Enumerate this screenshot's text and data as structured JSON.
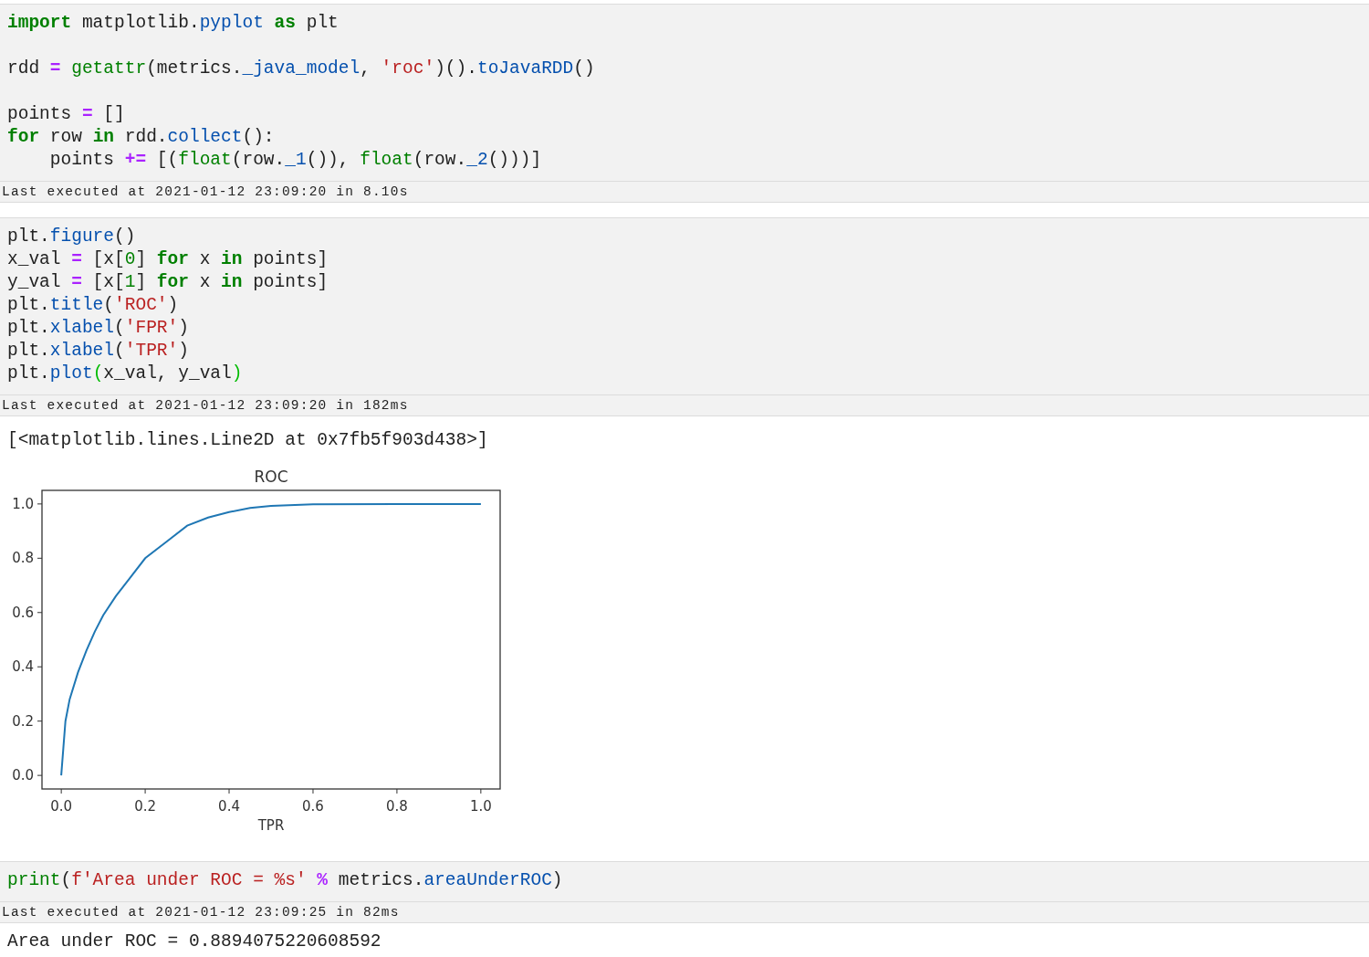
{
  "cells": [
    {
      "kind": "code",
      "lines": [
        {
          "tokens": [
            {
              "kind": "kw",
              "text": "import"
            },
            {
              "kind": "p",
              "text": " matplotlib."
            },
            {
              "kind": "prop",
              "text": "pyplot"
            },
            {
              "kind": "kw",
              "text": " as"
            },
            {
              "kind": "p",
              "text": " plt"
            }
          ]
        },
        {
          "gap_before": true,
          "tokens": [
            {
              "kind": "p",
              "text": "rdd "
            },
            {
              "kind": "op",
              "text": "="
            },
            {
              "kind": "bi",
              "text": " getattr"
            },
            {
              "kind": "p",
              "text": "(metrics."
            },
            {
              "kind": "prop",
              "text": "_java_model"
            },
            {
              "kind": "p",
              "text": ", "
            },
            {
              "kind": "str",
              "text": "'roc'"
            },
            {
              "kind": "p",
              "text": ")()."
            },
            {
              "kind": "prop",
              "text": "toJavaRDD"
            },
            {
              "kind": "p",
              "text": "()"
            }
          ]
        },
        {
          "gap_before": true,
          "tokens": [
            {
              "kind": "p",
              "text": "points "
            },
            {
              "kind": "op",
              "text": "="
            },
            {
              "kind": "p",
              "text": " []"
            }
          ]
        },
        {
          "tokens": [
            {
              "kind": "kw",
              "text": "for"
            },
            {
              "kind": "p",
              "text": " row "
            },
            {
              "kind": "kw",
              "text": "in"
            },
            {
              "kind": "p",
              "text": " rdd."
            },
            {
              "kind": "prop",
              "text": "collect"
            },
            {
              "kind": "p",
              "text": "():"
            }
          ]
        },
        {
          "tokens": [
            {
              "kind": "p",
              "text": "    points "
            },
            {
              "kind": "op",
              "text": "+="
            },
            {
              "kind": "p",
              "text": " [("
            },
            {
              "kind": "bi",
              "text": "float"
            },
            {
              "kind": "p",
              "text": "(row."
            },
            {
              "kind": "prop",
              "text": "_1"
            },
            {
              "kind": "p",
              "text": "()), "
            },
            {
              "kind": "bi",
              "text": "float"
            },
            {
              "kind": "p",
              "text": "(row."
            },
            {
              "kind": "prop",
              "text": "_2"
            },
            {
              "kind": "p",
              "text": "()))]"
            }
          ]
        }
      ],
      "footer": "Last executed at 2021-01-12 23:09:20 in 8.10s"
    },
    {
      "kind": "code",
      "lines": [
        {
          "tokens": [
            {
              "kind": "p",
              "text": "plt."
            },
            {
              "kind": "prop",
              "text": "figure"
            },
            {
              "kind": "p",
              "text": "()"
            }
          ]
        },
        {
          "tokens": [
            {
              "kind": "p",
              "text": "x_val "
            },
            {
              "kind": "op",
              "text": "="
            },
            {
              "kind": "p",
              "text": " [x["
            },
            {
              "kind": "num",
              "text": "0"
            },
            {
              "kind": "p",
              "text": "] "
            },
            {
              "kind": "kw",
              "text": "for"
            },
            {
              "kind": "p",
              "text": " x "
            },
            {
              "kind": "kw",
              "text": "in"
            },
            {
              "kind": "p",
              "text": " points]"
            }
          ]
        },
        {
          "tokens": [
            {
              "kind": "p",
              "text": "y_val "
            },
            {
              "kind": "op",
              "text": "="
            },
            {
              "kind": "p",
              "text": " [x["
            },
            {
              "kind": "num",
              "text": "1"
            },
            {
              "kind": "p",
              "text": "] "
            },
            {
              "kind": "kw",
              "text": "for"
            },
            {
              "kind": "p",
              "text": " x "
            },
            {
              "kind": "kw",
              "text": "in"
            },
            {
              "kind": "p",
              "text": " points]"
            }
          ]
        },
        {
          "tokens": [
            {
              "kind": "p",
              "text": "plt."
            },
            {
              "kind": "prop",
              "text": "title"
            },
            {
              "kind": "p",
              "text": "("
            },
            {
              "kind": "str",
              "text": "'ROC'"
            },
            {
              "kind": "p",
              "text": ")"
            }
          ]
        },
        {
          "tokens": [
            {
              "kind": "p",
              "text": "plt."
            },
            {
              "kind": "prop",
              "text": "xlabel"
            },
            {
              "kind": "p",
              "text": "("
            },
            {
              "kind": "str",
              "text": "'FPR'"
            },
            {
              "kind": "p",
              "text": ")"
            }
          ]
        },
        {
          "tokens": [
            {
              "kind": "p",
              "text": "plt."
            },
            {
              "kind": "prop",
              "text": "xlabel"
            },
            {
              "kind": "p",
              "text": "("
            },
            {
              "kind": "str",
              "text": "'TPR'"
            },
            {
              "kind": "p",
              "text": ")"
            }
          ]
        },
        {
          "tokens": [
            {
              "kind": "p",
              "text": "plt."
            },
            {
              "kind": "prop",
              "text": "plot"
            },
            {
              "kind": "match",
              "text": "("
            },
            {
              "kind": "p",
              "text": "x_val, y_val"
            },
            {
              "kind": "match",
              "text": ")"
            }
          ]
        }
      ],
      "footer": "Last executed at 2021-01-12 23:09:20 in 182ms",
      "outputs": [
        {
          "kind": "text",
          "text": "[<matplotlib.lines.Line2D at 0x7fb5f903d438>]"
        },
        {
          "kind": "chart",
          "chart_data": {
            "type": "line",
            "title": "ROC",
            "xlabel": "TPR",
            "x": [
              0,
              0.005,
              0.01,
              0.02,
              0.04,
              0.06,
              0.08,
              0.1,
              0.13,
              0.16,
              0.2,
              0.25,
              0.3,
              0.35,
              0.4,
              0.45,
              0.5,
              0.6,
              0.8,
              1.0
            ],
            "series": [
              {
                "color": "#1f77b4",
                "values": [
                  0,
                  0.1,
                  0.2,
                  0.28,
                  0.38,
                  0.46,
                  0.53,
                  0.59,
                  0.66,
                  0.72,
                  0.8,
                  0.86,
                  0.92,
                  0.95,
                  0.97,
                  0.985,
                  0.993,
                  0.999,
                  1.0,
                  1.0
                ]
              }
            ],
            "xticks": [
              {
                "value": 0,
                "label": "0.0"
              },
              0.2,
              0.4,
              0.6,
              0.8,
              {
                "value": 1,
                "label": "1.0"
              }
            ],
            "yticks": [
              {
                "value": 0,
                "label": "0.0"
              },
              0.2,
              0.4,
              0.6,
              0.8,
              {
                "value": 1,
                "label": "1.0"
              }
            ],
            "xlim": [
              -0.046,
              1.046
            ],
            "ylim": [
              -0.05,
              1.05
            ]
          }
        }
      ]
    },
    {
      "kind": "code",
      "lines": [
        {
          "tokens": [
            {
              "kind": "bi",
              "text": "print"
            },
            {
              "kind": "p",
              "text": "("
            },
            {
              "kind": "str",
              "text": "f'Area under ROC = %s'"
            },
            {
              "kind": "op",
              "text": " %"
            },
            {
              "kind": "p",
              "text": " metrics."
            },
            {
              "kind": "prop",
              "text": "areaUnderROC"
            },
            {
              "kind": "p",
              "text": ")"
            }
          ]
        }
      ],
      "footer": "Last executed at 2021-01-12 23:09:25 in 82ms",
      "outputs": [
        {
          "kind": "text",
          "text": "Area under ROC = 0.8894075220608592"
        }
      ]
    }
  ]
}
